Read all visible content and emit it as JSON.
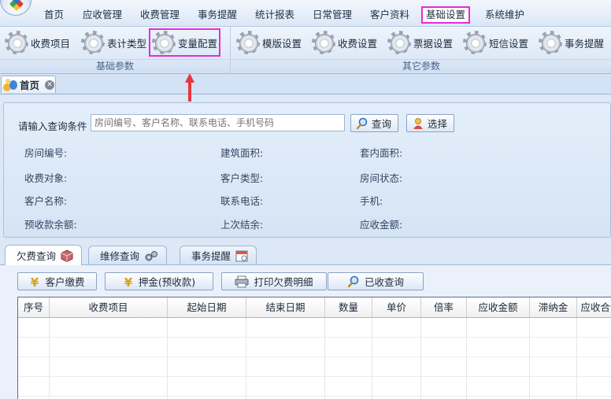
{
  "menu": {
    "items": [
      "首页",
      "应收管理",
      "收费管理",
      "事务提醒",
      "统计报表",
      "日常管理",
      "客户资料",
      "基础设置",
      "系统维护"
    ],
    "active_index": 7
  },
  "ribbon": {
    "group1": {
      "label": "基础参数",
      "buttons": [
        "收费项目",
        "表计类型",
        "变量配置"
      ]
    },
    "group2": {
      "label": "其它参数",
      "buttons": [
        "模版设置",
        "收费设置",
        "票据设置",
        "短信设置",
        "事务提醒"
      ]
    }
  },
  "page_tab": {
    "label": "首页"
  },
  "query": {
    "label": "请输入查询条件",
    "placeholder": "房间编号、客户名称、联系电话、手机号码",
    "search_button": "查询",
    "select_button": "选择",
    "fields": [
      "房间编号:",
      "建筑面积:",
      "套内面积:",
      "收费对象:",
      "客户类型:",
      "房间状态:",
      "客户名称:",
      "联系电话:",
      "手机:",
      "预收款余额:",
      "上次结余:",
      "应收金额:"
    ]
  },
  "bottom_tabs": [
    "欠费查询",
    "维修查询",
    "事务提醒"
  ],
  "actions": [
    "客户缴费",
    "押金(预收款)",
    "打印欠费明细",
    "已收查询"
  ],
  "grid": {
    "columns": [
      "序号",
      "收费项目",
      "起始日期",
      "结束日期",
      "数量",
      "单价",
      "倍率",
      "应收金额",
      "滞纳金",
      "应收合计"
    ]
  },
  "colors": {
    "highlight": "#e62ad6",
    "arrow": "#e8363f"
  }
}
